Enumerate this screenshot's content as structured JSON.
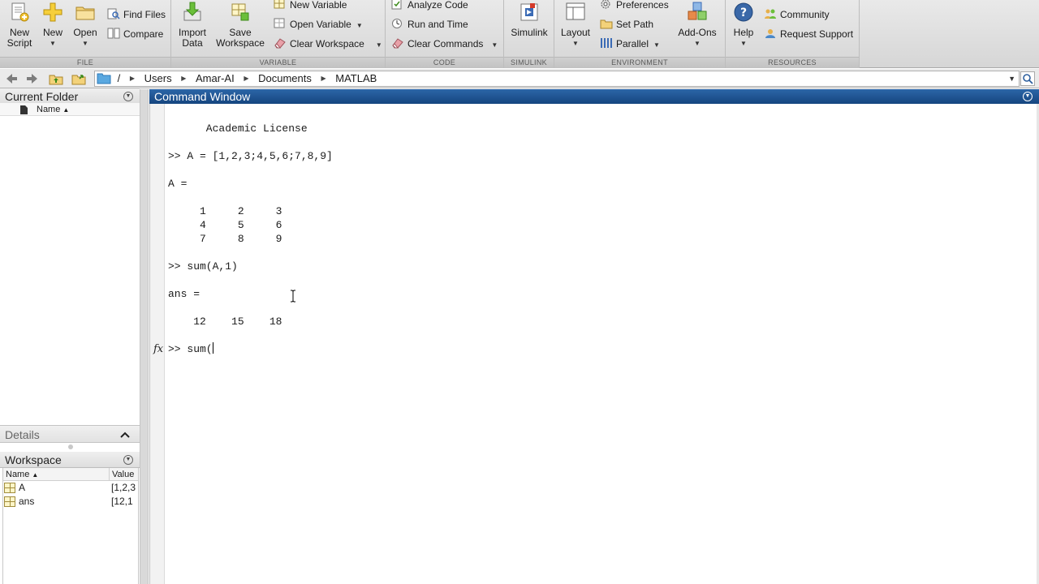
{
  "toolstrip": {
    "file": {
      "label": "FILE",
      "new_script": "New\nScript",
      "new_script_l1": "New",
      "new_script_l2": "Script",
      "new": "New",
      "open": "Open",
      "find_files": "Find Files",
      "compare": "Compare"
    },
    "variable": {
      "label": "VARIABLE",
      "import_l1": "Import",
      "import_l2": "Data",
      "save_l1": "Save",
      "save_l2": "Workspace",
      "new_variable": "New Variable",
      "open_variable": "Open Variable",
      "clear_workspace": "Clear Workspace"
    },
    "code": {
      "label": "CODE",
      "analyze_code": "Analyze Code",
      "run_and_time": "Run and Time",
      "clear_commands": "Clear Commands"
    },
    "simulink": {
      "label": "SIMULINK",
      "simulink": "Simulink"
    },
    "environment": {
      "label": "ENVIRONMENT",
      "layout": "Layout",
      "preferences": "Preferences",
      "set_path": "Set Path",
      "parallel": "Parallel",
      "add_ons": "Add-Ons"
    },
    "resources": {
      "label": "RESOURCES",
      "help": "Help",
      "community": "Community",
      "request_support": "Request Support"
    }
  },
  "address": {
    "root": "/",
    "crumbs": [
      "Users",
      "Amar-AI",
      "Documents",
      "MATLAB"
    ]
  },
  "current_folder": {
    "title": "Current Folder",
    "col_name": "Name",
    "sort_glyph": "▲"
  },
  "details": {
    "title": "Details"
  },
  "workspace": {
    "title": "Workspace",
    "col_name": "Name",
    "col_value": "Value",
    "sort_glyph": "▲",
    "rows": [
      {
        "name": "A",
        "value": "[1,2,3"
      },
      {
        "name": "ans",
        "value": "[12,1"
      }
    ]
  },
  "command_window": {
    "title": "Command Window",
    "fx": "fx",
    "lines": [
      "      Academic License",
      ">> A = [1,2,3;4,5,6;7,8,9]",
      "A =",
      "     1     2     3",
      "     4     5     6",
      "     7     8     9",
      ">> sum(A,1)",
      "ans =",
      "    12    15    18",
      ">> sum("
    ]
  },
  "icons": {
    "back": "back-arrow-icon",
    "forward": "forward-arrow-icon",
    "up_folder": "up-folder-icon",
    "browse": "browse-folder-icon",
    "search": "search-icon"
  },
  "colors": {
    "accent": "#1c4f8e",
    "toolstrip": "#dcdcdc"
  }
}
